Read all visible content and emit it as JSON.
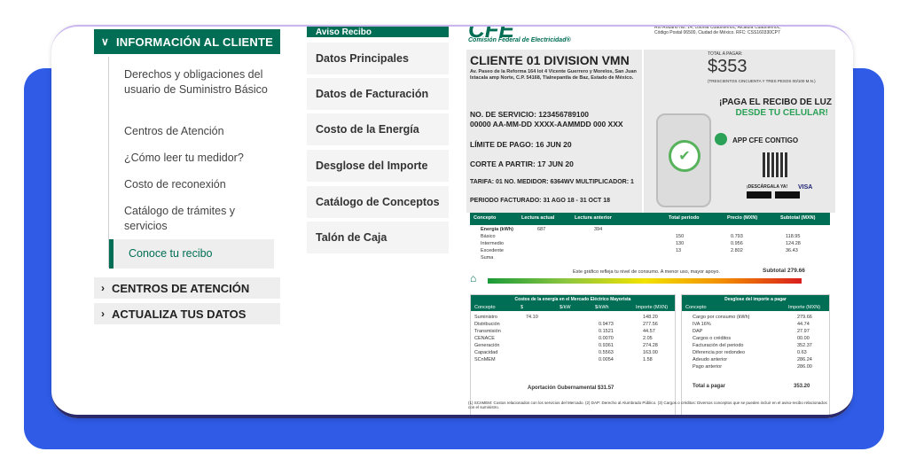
{
  "sidebar": {
    "section_info": "INFORMACIÓN AL CLIENTE",
    "items": [
      {
        "label": "Derechos y obligaciones del usuario de Suministro Básico"
      },
      {
        "label": "Centros de Atención"
      },
      {
        "label": "¿Cómo leer tu medidor?"
      },
      {
        "label": "Costo de reconexión"
      },
      {
        "label": "Catálogo de trámites y servicios"
      },
      {
        "label": "Conoce tu recibo"
      }
    ],
    "section_centros": "CENTROS DE ATENCIÓN",
    "section_datos": "ACTUALIZA TUS DATOS"
  },
  "tabs": {
    "aviso": "Aviso Recibo",
    "items": [
      {
        "label": "Datos Principales"
      },
      {
        "label": "Datos de Facturación"
      },
      {
        "label": "Costo de la Energía"
      },
      {
        "label": "Desglose del Importe"
      },
      {
        "label": "Catálogo de Conceptos"
      },
      {
        "label": "Talón de Caja"
      }
    ]
  },
  "receipt": {
    "logo": "CFE",
    "logo_sub": "Comisión Federal de Electricidad®",
    "address_right": "Río Ródano No. 14, colonia Cuauhtémoc, Alcaldía Cuauhtémoc, Código Postal 06500, Ciudad de México. RFC: CSS160330CP7",
    "client_name": "CLIENTE 01 DIVISION VMN",
    "client_address": "Av. Paseo de la Reforma 164 lot 4 Vicente Guerrero y Morelos, San Juan Ixtacala amp Norte, C.P. 54168, Tlalnepantla de Baz, Estado de México.",
    "servicio": "NO. DE SERVICIO: 123456789100",
    "barcode_text": "00000 AA-MM-DD XXXX-AAMMDD 000 XXX",
    "limite": "LÍMITE DE PAGO: 16 JUN 20",
    "corte": "CORTE A PARTIR: 17 JUN 20",
    "tarifa": "TARIFA: 01 NO. MEDIDOR: 6364WV MULTIPLICADOR: 1",
    "periodo": "PERIODO FACTURADO: 31 AGO 18 - 31 OCT 18",
    "total_label": "TOTAL A PAGAR:",
    "total_amount": "$353",
    "total_text": "(TRESCIENTOS CINCUENTA Y TRES PESOS 00/100 M.N.)",
    "paga_line1": "¡PAGA EL RECIBO DE LUZ",
    "paga_line2": "DESDE TU CELULAR!",
    "app_name": "APP CFE CONTIGO",
    "descarga": "¡DESCÁRGALA YA!",
    "visa": "VISA",
    "table_headers": [
      "Concepto",
      "Lectura actual",
      "Lectura anterior",
      "Total periodo",
      "Precio (MXN)",
      "Subtotal (MXN)"
    ],
    "energia_rows": [
      {
        "c": "Energía (kWh)",
        "a": "687",
        "b": "394",
        "t": "",
        "p": "",
        "s": ""
      },
      {
        "c": "Básico",
        "a": "",
        "b": "",
        "t": "150",
        "p": "0.793",
        "s": "118.95"
      },
      {
        "c": "Intermedio",
        "a": "",
        "b": "",
        "t": "130",
        "p": "0.956",
        "s": "124.28"
      },
      {
        "c": "Excedente",
        "a": "",
        "b": "",
        "t": "13",
        "p": "2.802",
        "s": "36.43"
      },
      {
        "c": "Suma",
        "a": "",
        "b": "",
        "t": "",
        "p": "",
        "s": ""
      }
    ],
    "grafico_text": "Este gráfico refleja tu nivel de consumo. A menor uso, mayor apoyo.",
    "subtotal_label": "Subtotal",
    "subtotal_value": "279.66",
    "costos_title": "Costos de la energía en el Mercado Eléctrico Mayorista",
    "costos_headers": [
      "Concepto",
      "$",
      "$/kW",
      "$/kWh",
      "Importe (MXN)"
    ],
    "costos_rows": [
      {
        "c": "Suministro",
        "v1": "74.10",
        "v2": "",
        "v3": "",
        "imp": "148.20"
      },
      {
        "c": "Distribución",
        "v1": "",
        "v2": "",
        "v3": "0.9473",
        "imp": "277.56"
      },
      {
        "c": "Transmisión",
        "v1": "",
        "v2": "",
        "v3": "0.1521",
        "imp": "44.57"
      },
      {
        "c": "CENACE",
        "v1": "",
        "v2": "",
        "v3": "0.0070",
        "imp": "2.05"
      },
      {
        "c": "Generación",
        "v1": "",
        "v2": "",
        "v3": "0.9361",
        "imp": "274.28"
      },
      {
        "c": "Capacidad",
        "v1": "",
        "v2": "",
        "v3": "0.5563",
        "imp": "163.00"
      },
      {
        "c": "SCnMEM",
        "v1": "",
        "v2": "",
        "v3": "0.0054",
        "imp": "1.58"
      }
    ],
    "aportacion": "Aportación Gubernamental $31.57",
    "desglose_title": "Desglose del importe a pagar",
    "desglose_headers": [
      "Concepto",
      "Importe (MXN)"
    ],
    "desglose_rows": [
      {
        "c": "Cargo por consumo (kWh)",
        "imp": "279.66"
      },
      {
        "c": "IVA 16%",
        "imp": "44.74"
      },
      {
        "c": "DAP",
        "imp": "27.97"
      },
      {
        "c": "Cargos o créditos",
        "imp": "00.00"
      },
      {
        "c": "Facturación del periodo",
        "imp": "352.37"
      },
      {
        "c": "Diferencia por redondeo",
        "imp": "0.63"
      },
      {
        "c": "Adeudo anterior",
        "imp": "286.24"
      },
      {
        "c": "Pago anterior",
        "imp": "286.00"
      }
    ],
    "total_pagar_label": "Total a pagar",
    "total_pagar_value": "353.20",
    "footnote": "(1) SCnMEM: Costos relacionados con los servicios del Mercado. (2) DAP: Derecho al Alumbrado Público. (3) Cargos o créditos: Diversos conceptos que se pueden incluir en el aviso-recibo relacionados con el suministro."
  },
  "colors": {
    "green": "#006e54",
    "blue_back": "#2f5be6"
  }
}
